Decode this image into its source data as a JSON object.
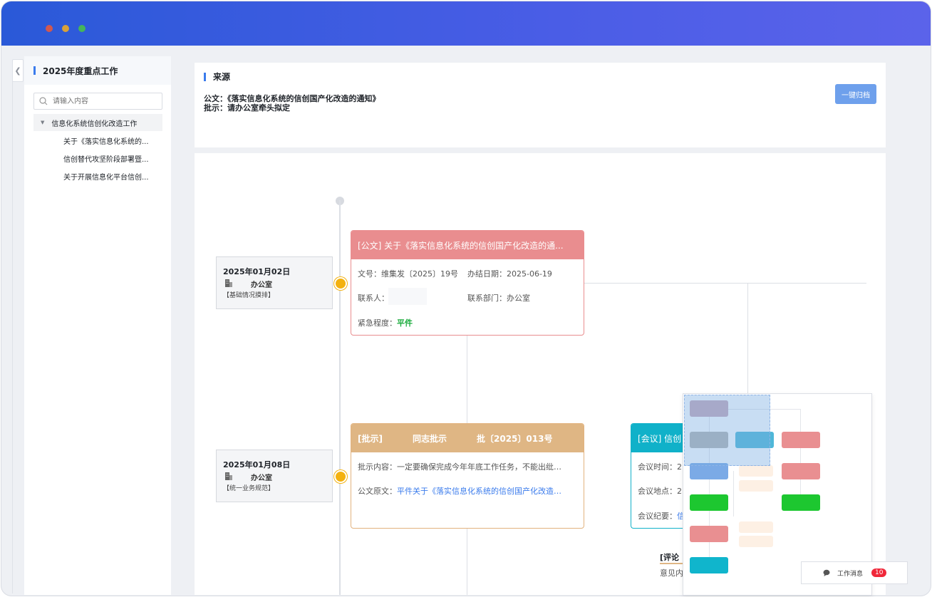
{
  "sidebar": {
    "title": "2025年度重点工作",
    "search_placeholder": "请输入内容",
    "group": "信息化系统信创化改造工作",
    "items": [
      "关于《落实信息化系统的...",
      "信创替代攻坚阶段部署暨...",
      "关于开展信息化平台信创..."
    ]
  },
  "source": {
    "title": "来源",
    "doc_line": "公文：《落实信息化系统的信创国产化改造的通知》",
    "note_line": "批示：请办公室牵头拟定",
    "archive_button": "一键归档"
  },
  "timeline": {
    "entries": [
      {
        "date": "2025年01月02日",
        "office": "办公室",
        "tag": "【基础情况摸排】"
      },
      {
        "date": "2025年01月08日",
        "office": "办公室",
        "tag": "【统一业务规范】"
      }
    ]
  },
  "event_doc": {
    "header": "[公文] 关于《落实信息化系统的信创国产化改造的通...",
    "doc_no": "文号：维集发〔2025〕19号",
    "deadline": "办结日期：2025-06-19",
    "contact": "联系人：",
    "dept": "联系部门：办公室",
    "urgency_label": "紧急程度：",
    "urgency_value": "平件"
  },
  "event_note": {
    "type": "[批示]",
    "approve": "同志批示",
    "number": "批〔2025〕013号",
    "content": "批示内容：一定要确保完成今年年底工作任务，不能出纰…",
    "orig_label": "公文原文：",
    "orig_link": "平件关于《落实信息化系统的信创国产化改造…"
  },
  "event_meeting": {
    "header": "[会议] 信创",
    "time": "会议时间：2",
    "place": "会议地点：2",
    "summary_label": "会议纪要：",
    "summary_link": "信"
  },
  "comment": {
    "title": "[评论",
    "text": "意见内"
  },
  "messages": {
    "label": "工作消息",
    "count": "10"
  },
  "colors": {
    "accent": "#3a7bec",
    "doc": "#e98d8f",
    "note": "#dfb684",
    "meeting": "#10b1c9",
    "node": "#f3b10f",
    "green": "#1aab3c"
  },
  "minimap_colors": [
    "#c8a9b9",
    "#b5b5b2",
    "#4fb7d8",
    "#e98f91",
    "#7baae6",
    "#1dc730",
    "#e98f91",
    "#10b5cc",
    "#fdf0e4"
  ]
}
